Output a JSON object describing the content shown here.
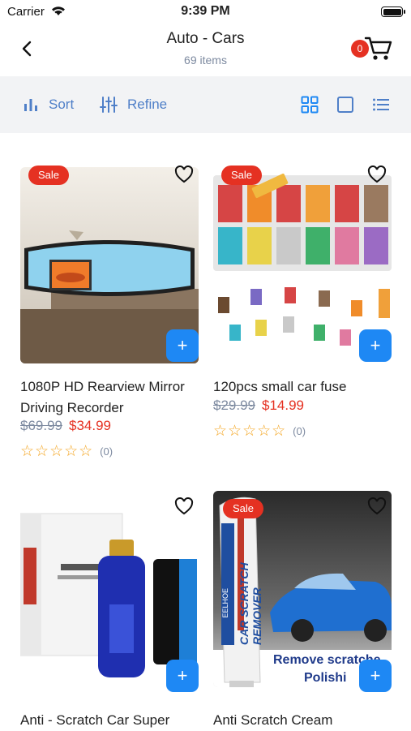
{
  "status": {
    "carrier": "Carrier",
    "time": "9:39 PM"
  },
  "header": {
    "title": "Auto - Cars",
    "subtitle": "69 items",
    "cart_count": "0"
  },
  "toolbar": {
    "sort": "Sort",
    "refine": "Refine"
  },
  "products": [
    {
      "sale": "Sale",
      "name": "1080P HD Rearview Mirror Driving Recorder",
      "old_price": "$69.99",
      "price": "$34.99",
      "stars": "☆☆☆☆☆",
      "reviews": "(0)"
    },
    {
      "sale": "Sale",
      "name": "120pcs small car fuse",
      "old_price": "$29.99",
      "price": "$14.99",
      "stars": "☆☆☆☆☆",
      "reviews": "(0)"
    },
    {
      "name": "Anti - Scratch Car Super"
    },
    {
      "sale": "Sale",
      "name": "Anti Scratch Cream",
      "img_text": {
        "brand": "EELHOE",
        "product": "CAR SCRATCH REMOVER",
        "tag": "Remove scratche",
        "tag2": "Polishi"
      }
    }
  ],
  "colors": {
    "accent": "#1e88f4",
    "sale": "#e53122",
    "toolbar": "#4f7fc8",
    "star": "#f4a623"
  }
}
